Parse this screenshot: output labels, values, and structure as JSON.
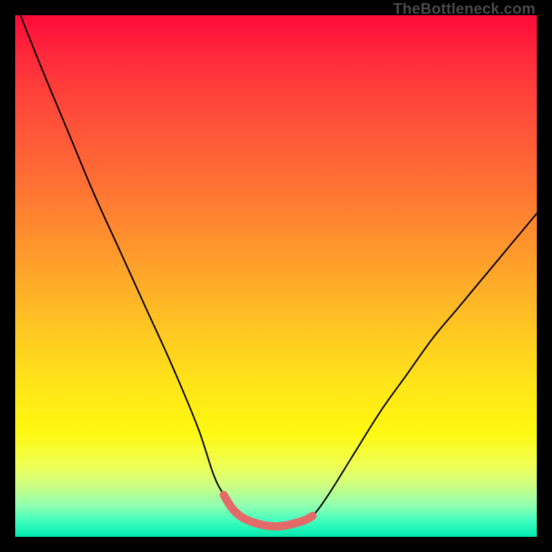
{
  "watermark": "TheBottleneck.com",
  "chart_data": {
    "type": "line",
    "title": "",
    "xlabel": "",
    "ylabel": "",
    "xlim": [
      0,
      100
    ],
    "ylim": [
      0,
      100
    ],
    "series": [
      {
        "name": "black-curve",
        "color": "#000000",
        "x": [
          1,
          5,
          10,
          15,
          20,
          25,
          30,
          35,
          38,
          40,
          42,
          45,
          50,
          55,
          57,
          60,
          65,
          70,
          75,
          80,
          85,
          90,
          95,
          100
        ],
        "y": [
          100,
          90,
          78,
          66,
          55,
          44,
          33,
          21,
          12,
          8,
          5,
          3,
          2,
          3,
          4,
          8,
          16,
          24,
          31,
          38,
          44,
          50,
          56,
          62
        ]
      },
      {
        "name": "red-flat-segment",
        "color": "#e46a6a",
        "x": [
          40,
          42,
          45,
          50,
          55,
          57
        ],
        "y": [
          8,
          5,
          3,
          2,
          3,
          4
        ]
      }
    ],
    "gradient_stops": [
      {
        "pos": 0.0,
        "color": "#ff0a3a"
      },
      {
        "pos": 0.3,
        "color": "#ff6a35"
      },
      {
        "pos": 0.58,
        "color": "#ffc024"
      },
      {
        "pos": 0.8,
        "color": "#fff810"
      },
      {
        "pos": 0.94,
        "color": "#90ffb0"
      },
      {
        "pos": 1.0,
        "color": "#00e8b0"
      }
    ],
    "legend": false,
    "grid": false
  }
}
